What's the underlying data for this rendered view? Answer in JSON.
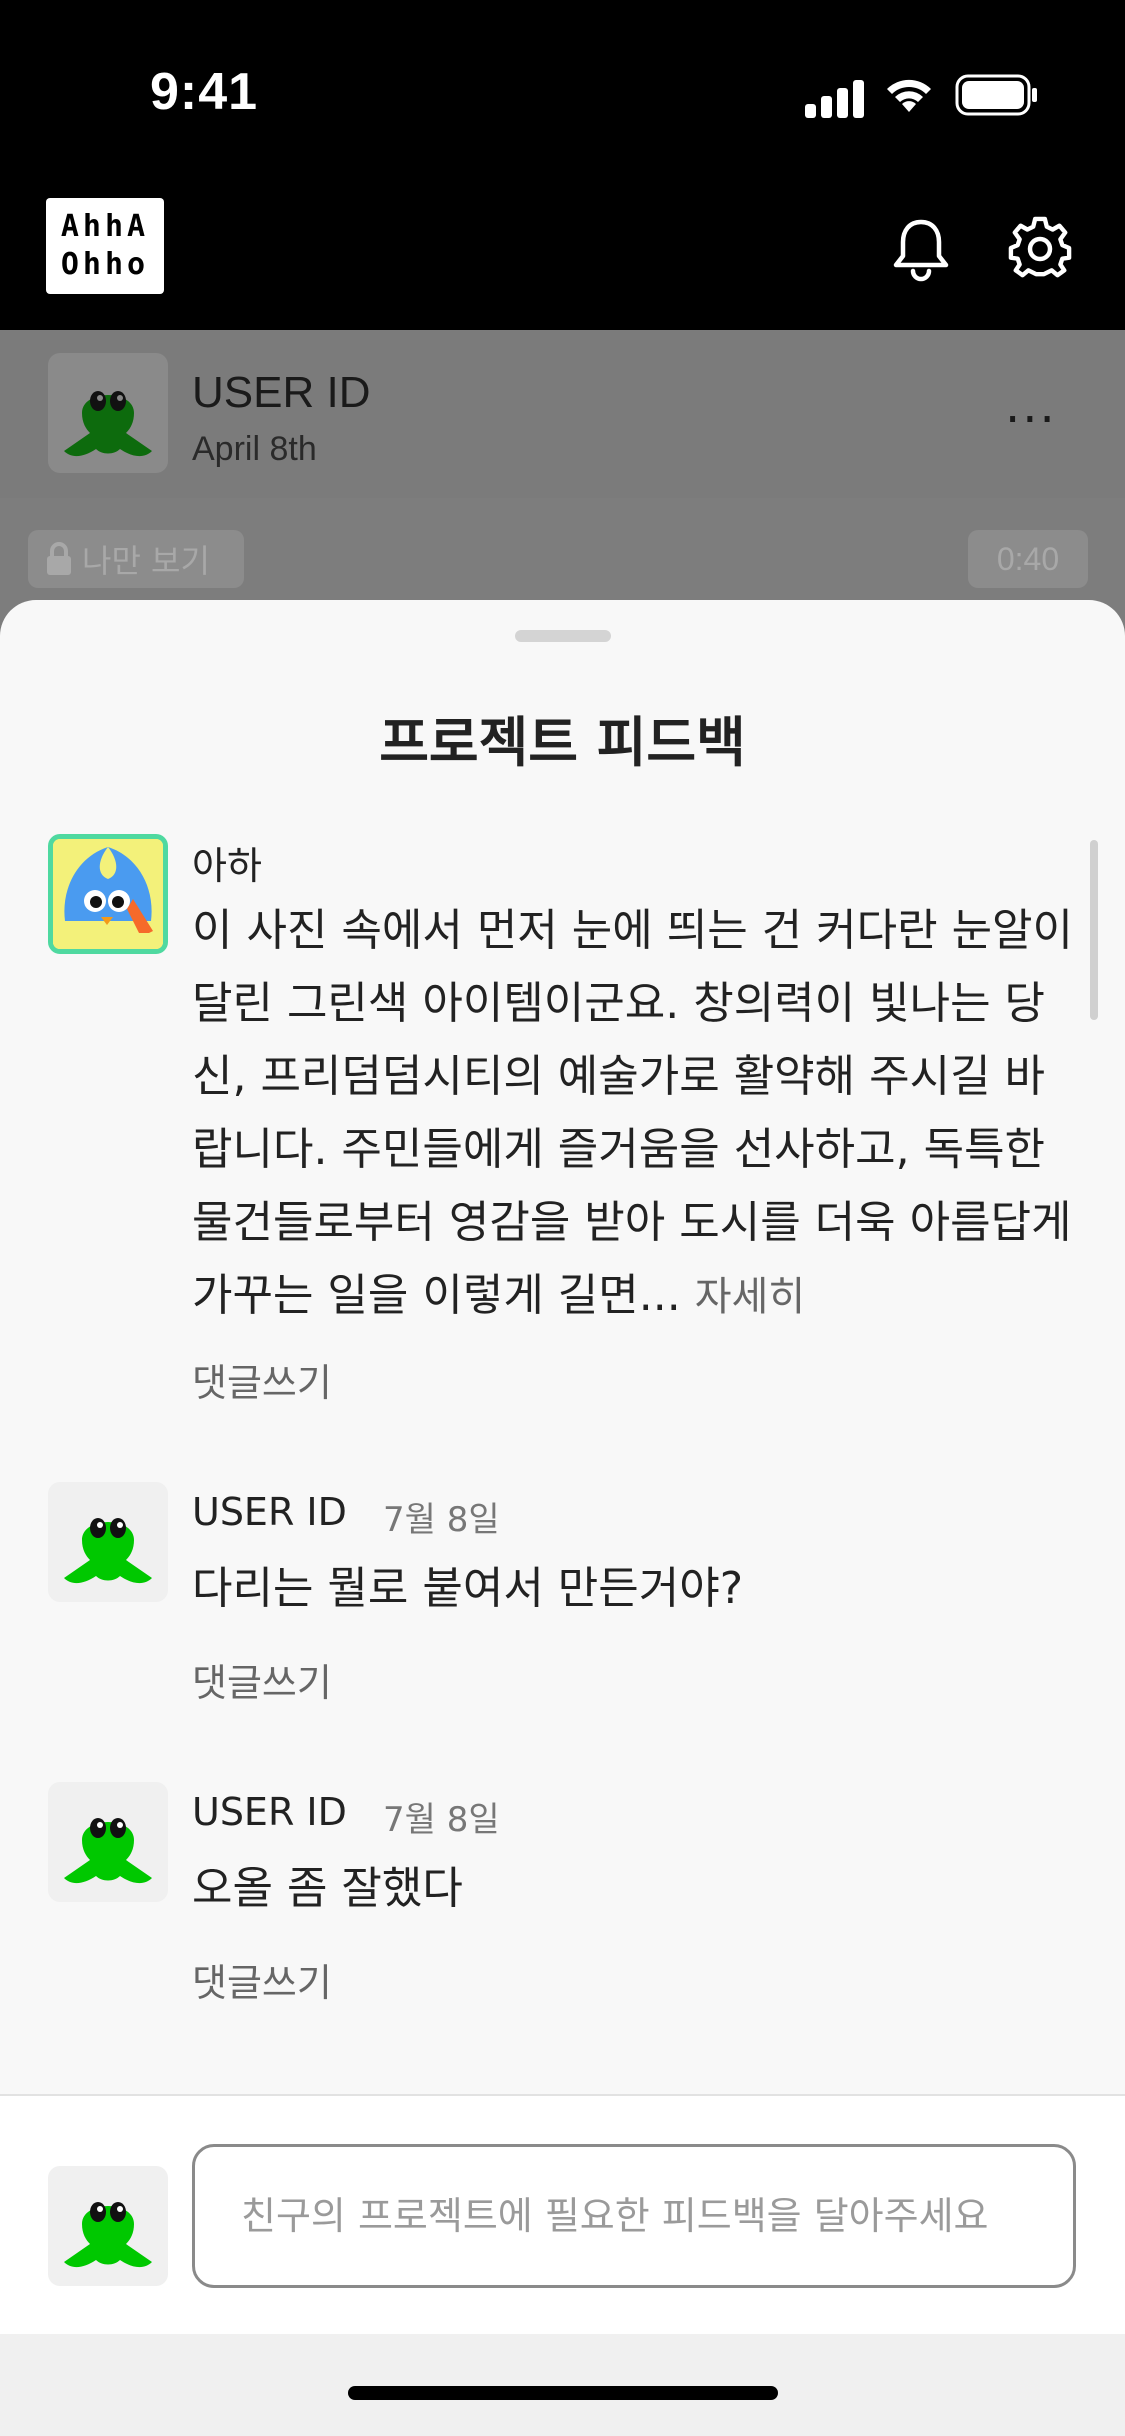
{
  "status_bar": {
    "time": "9:41"
  },
  "header": {
    "logo_line1": "AhhA",
    "logo_line2": "Ohho",
    "bell_icon": "bell-icon",
    "settings_icon": "gear-icon"
  },
  "post": {
    "user_id": "USER ID",
    "date": "April 8th",
    "more": "···",
    "privacy_label": "나만 보기",
    "duration": "0:40"
  },
  "sheet": {
    "title": "프로젝트 피드백",
    "comments": [
      {
        "name": "아하",
        "date": "",
        "body": "이 사진 속에서 먼저 눈에 띄는 건 커다란 눈알이 달린 그린색 아이템이군요. 창의력이 빛나는 당신, 프리덤덤시티의 예술가로 활약해 주시길 바랍니다. 주민들에게 즐거움을 선사하고, 독특한 물건들로부터 영감을 받아 도시를 더욱 아름답게 가꾸는 일을 이렇게 길면...",
        "more_label": "자세히",
        "reply_label": "댓글쓰기"
      },
      {
        "name": "USER ID",
        "date": "7월 8일",
        "body": "다리는 뭘로 붙여서 만든거야?",
        "reply_label": "댓글쓰기"
      },
      {
        "name": "USER ID",
        "date": "7월 8일",
        "body": "오올 좀 잘했다",
        "reply_label": "댓글쓰기"
      }
    ],
    "input_placeholder": "친구의 프로젝트에 필요한 피드백을 달아주세요"
  },
  "colors": {
    "accent_green": "#00c800",
    "ai_border": "#4fd9a0",
    "sheet_bg": "#f8f8f8"
  }
}
